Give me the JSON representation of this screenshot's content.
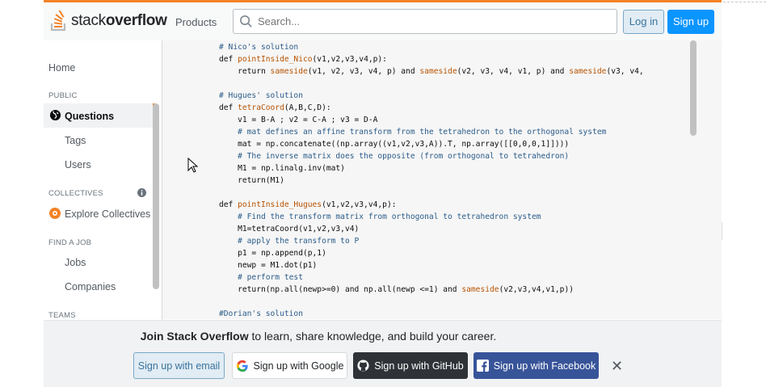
{
  "header": {
    "logo_plain": "stack",
    "logo_bold": "overflow",
    "products": "Products",
    "search_placeholder": "Search...",
    "login": "Log in",
    "signup": "Sign up"
  },
  "sidebar": {
    "home": "Home",
    "public_heading": "PUBLIC",
    "questions": "Questions",
    "tags": "Tags",
    "users": "Users",
    "collectives_heading": "COLLECTIVES",
    "explore_collectives": "Explore Collectives",
    "find_job_heading": "FIND A JOB",
    "jobs": "Jobs",
    "companies": "Companies",
    "teams_heading": "TEAMS"
  },
  "footer": {
    "join_bold": "Join Stack Overflow",
    "join_rest": " to learn, share knowledge, and build your career.",
    "email": "Sign up with email",
    "google": "Sign up with Google",
    "github": "Sign up with GitHub",
    "facebook": "Sign up with Facebook",
    "close": "✕"
  },
  "colors": {
    "accent_orange": "#f48225",
    "primary_blue": "#0a95ff",
    "github_dark": "#2f3337",
    "facebook_blue": "#385499"
  },
  "code_lines": [
    [
      [
        "c",
        "# Nico's solution"
      ]
    ],
    [
      [
        "k",
        "def "
      ],
      [
        "f",
        "pointInside_Nico"
      ],
      [
        "k",
        "(v1,v2,v3,v4,p):"
      ]
    ],
    [
      [
        "k",
        "    return "
      ],
      [
        "f",
        "sameside"
      ],
      [
        "k",
        "(v1, v2, v3, v4, p) and "
      ],
      [
        "f",
        "sameside"
      ],
      [
        "k",
        "(v2, v3, v4, v1, p) and "
      ],
      [
        "f",
        "sameside"
      ],
      [
        "k",
        "(v3, v4,"
      ]
    ],
    [
      [
        "k",
        ""
      ]
    ],
    [
      [
        "c",
        "# Hugues' solution"
      ]
    ],
    [
      [
        "k",
        "def "
      ],
      [
        "f",
        "tetraCoord"
      ],
      [
        "k",
        "(A,B,C,D):"
      ]
    ],
    [
      [
        "k",
        "    v1 = B-A ; v2 = C-A ; v3 = D-A"
      ]
    ],
    [
      [
        "c",
        "    # mat defines an affine transform from the tetrahedron to the orthogonal system"
      ]
    ],
    [
      [
        "k",
        "    mat = np.concatenate((np.array((v1,v2,v3,A)).T, np.array([[0,0,0,1]])))"
      ]
    ],
    [
      [
        "c",
        "    # The inverse matrix does the opposite (from orthogonal to tetrahedron)"
      ]
    ],
    [
      [
        "k",
        "    M1 = np.linalg.inv(mat)"
      ]
    ],
    [
      [
        "k",
        "    return(M1)"
      ]
    ],
    [
      [
        "k",
        ""
      ]
    ],
    [
      [
        "k",
        "def "
      ],
      [
        "f",
        "pointInside_Hugues"
      ],
      [
        "k",
        "(v1,v2,v3,v4,p):"
      ]
    ],
    [
      [
        "c",
        "    # Find the transform matrix from orthogonal to tetrahedron system"
      ]
    ],
    [
      [
        "k",
        "    M1=tetraCoord(v1,v2,v3,v4)"
      ]
    ],
    [
      [
        "c",
        "    # apply the transform to P"
      ]
    ],
    [
      [
        "k",
        "    p1 = np.append(p,1)"
      ]
    ],
    [
      [
        "k",
        "    newp = M1.dot(p1)"
      ]
    ],
    [
      [
        "c",
        "    # perform test"
      ]
    ],
    [
      [
        "k",
        "    return(np.all(newp>=0) and np.all(newp <=1) and "
      ],
      [
        "f",
        "sameside"
      ],
      [
        "k",
        "(v2,v3,v4,v1,p))"
      ]
    ],
    [
      [
        "k",
        ""
      ]
    ],
    [
      [
        "c",
        "#Dorian's solution"
      ]
    ]
  ]
}
